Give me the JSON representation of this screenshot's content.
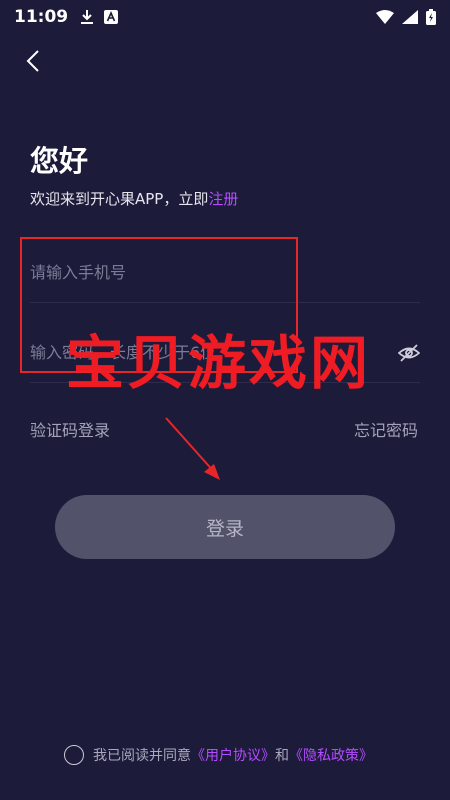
{
  "status_bar": {
    "time": "11:09",
    "icons": [
      "download-icon",
      "a-badge-icon",
      "wifi-icon",
      "signal-icon",
      "battery-charging-icon"
    ]
  },
  "header": {
    "back_icon": "chevron-left-icon"
  },
  "greeting": {
    "title": "您好",
    "welcome_prefix": "欢迎来到开心果APP，立即",
    "register_label": "注册"
  },
  "form": {
    "phone_placeholder": "请输入手机号",
    "password_placeholder": "输入密码，长度不少于6位",
    "password_toggle_icon": "eye-off-icon"
  },
  "links": {
    "sms_login": "验证码登录",
    "forgot_password": "忘记密码"
  },
  "login_button": {
    "label": "登录"
  },
  "agreement": {
    "prefix": "我已阅读并同意",
    "user_agreement": "《用户协议》",
    "conjunction": "和",
    "privacy_policy": "《隐私政策》"
  },
  "overlay": {
    "watermark": "宝贝游戏网"
  },
  "colors": {
    "background": "#1c1b3a",
    "accent": "#b44cff",
    "button_bg": "#52526b",
    "annotation_red": "#e8262a"
  }
}
